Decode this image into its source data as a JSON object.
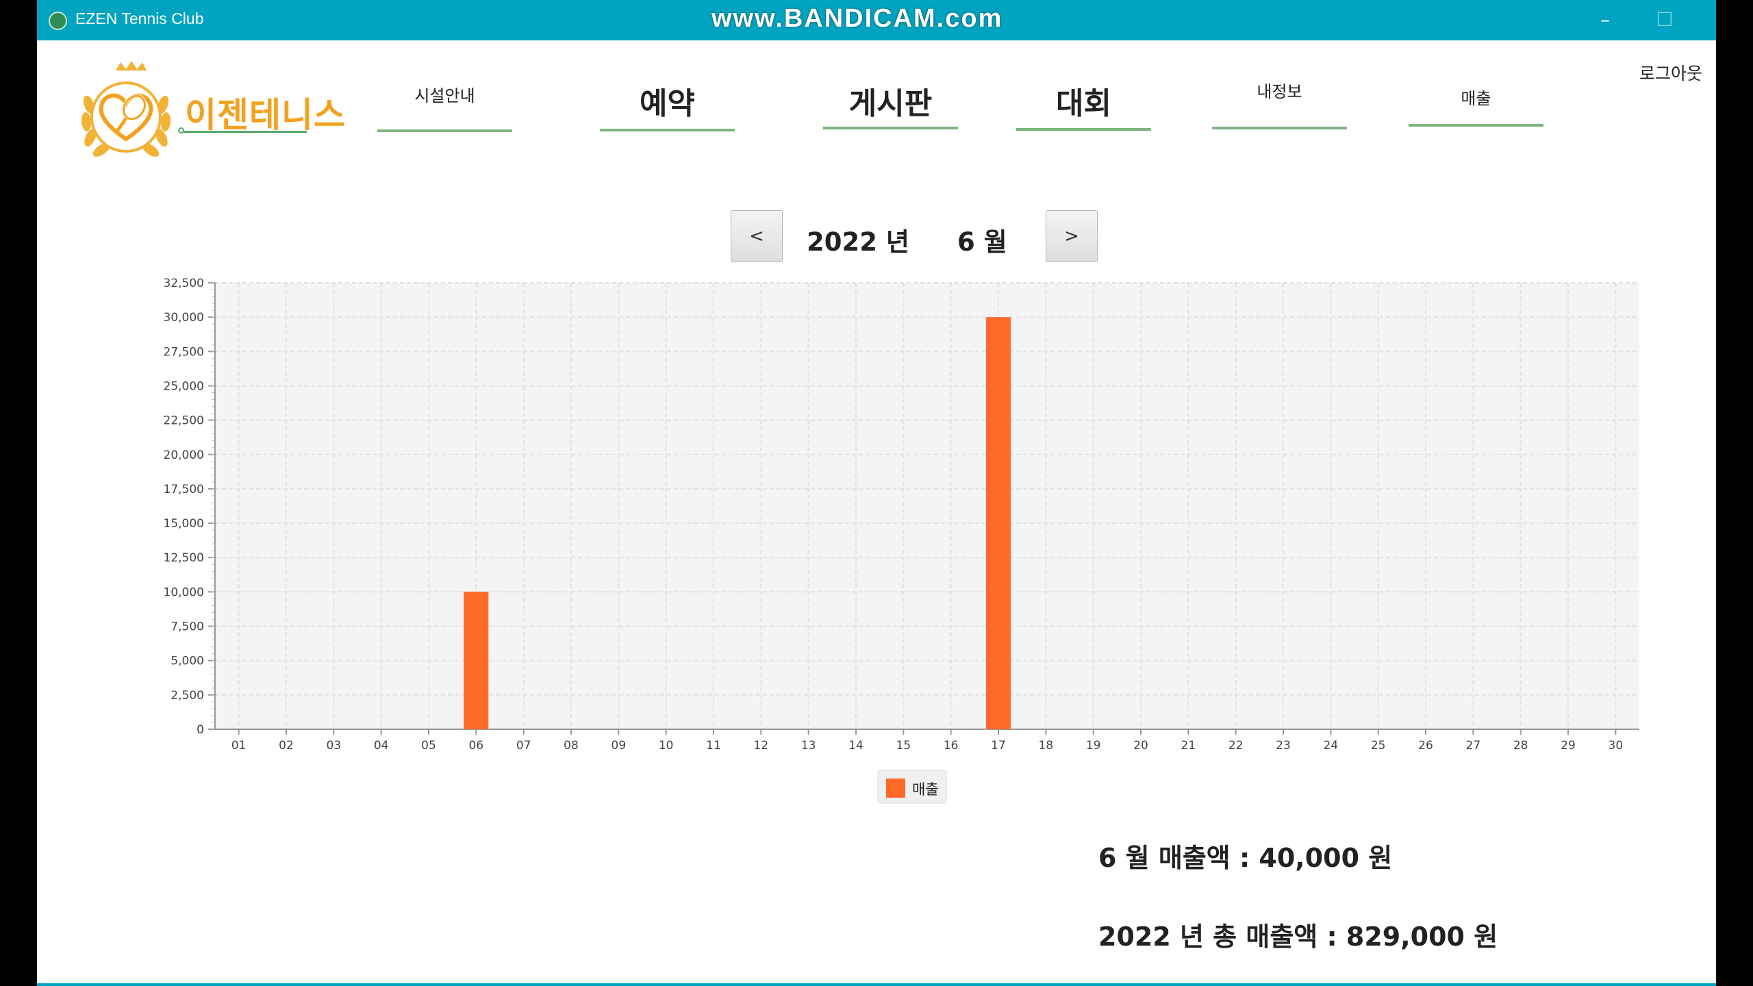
{
  "window": {
    "app_title": "EZEN Tennis Club",
    "watermark": "www.BANDICAM.com",
    "minimize_glyph": "–",
    "maximize_glyph": "☐",
    "close_glyph": "✕"
  },
  "header": {
    "logo_text": "이젠테니스",
    "logout": "로그아웃",
    "nav": [
      {
        "label": "시설안내"
      },
      {
        "label": "예약"
      },
      {
        "label": "게시판"
      },
      {
        "label": "대회"
      },
      {
        "label": "내정보"
      },
      {
        "label": "매출"
      }
    ]
  },
  "period": {
    "prev": "<",
    "next": ">",
    "year": "2022 년",
    "month": "6 월"
  },
  "colors": {
    "titlebar": "#00a4c0",
    "bar": "#ff6a28",
    "nav_underline": "#7cb67f",
    "logo": "#f3a11f"
  },
  "chart_data": {
    "type": "bar",
    "categories": [
      "01",
      "02",
      "03",
      "04",
      "05",
      "06",
      "07",
      "08",
      "09",
      "10",
      "11",
      "12",
      "13",
      "14",
      "15",
      "16",
      "17",
      "18",
      "19",
      "20",
      "21",
      "22",
      "23",
      "24",
      "25",
      "26",
      "27",
      "28",
      "29",
      "30"
    ],
    "series": [
      {
        "name": "매출",
        "values": [
          0,
          0,
          0,
          0,
          0,
          10000,
          0,
          0,
          0,
          0,
          0,
          0,
          0,
          0,
          0,
          0,
          30000,
          0,
          0,
          0,
          0,
          0,
          0,
          0,
          0,
          0,
          0,
          0,
          0,
          0
        ]
      }
    ],
    "yticks": [
      "0",
      "2,500",
      "5,000",
      "7,500",
      "10,000",
      "12,500",
      "15,000",
      "17,500",
      "20,000",
      "22,500",
      "25,000",
      "27,500",
      "30,000",
      "32,500"
    ],
    "ylim": [
      0,
      32500
    ],
    "grid": true,
    "legend": "bottom-center"
  },
  "summary": {
    "monthly": "6 월 매출액 : 40,000 원",
    "yearly": "2022 년 총 매출액 : 829,000 원"
  }
}
